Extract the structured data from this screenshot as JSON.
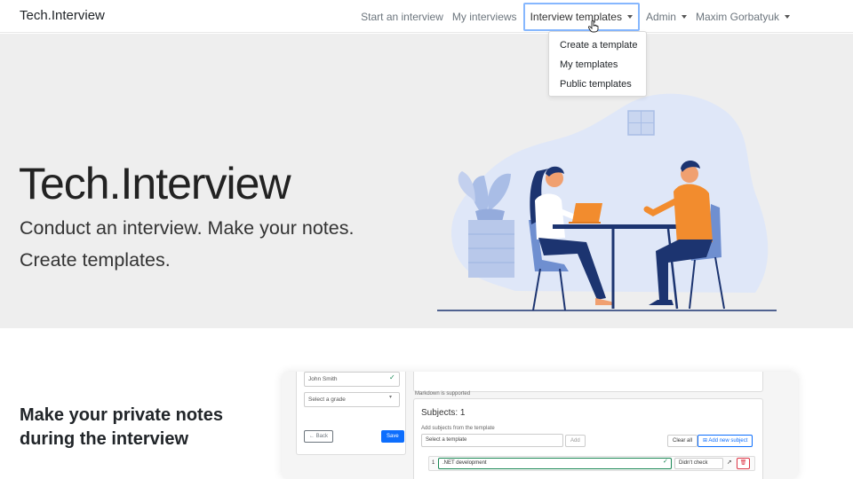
{
  "navbar": {
    "brand": "Tech.Interview",
    "items": [
      {
        "label": "Start an interview"
      },
      {
        "label": "My interviews"
      },
      {
        "label": "Interview templates"
      },
      {
        "label": "Admin"
      },
      {
        "label": "Maxim Gorbatyuk"
      }
    ]
  },
  "dropdown": {
    "items": [
      {
        "label": "Create a template"
      },
      {
        "label": "My templates"
      },
      {
        "label": "Public templates"
      }
    ]
  },
  "hero": {
    "title": "Tech.Interview",
    "subtitle_line1": "Conduct an interview. Make your notes.",
    "subtitle_line2": "Create templates."
  },
  "section2": {
    "title_line1": "Make your private notes",
    "title_line2": "during the interview"
  },
  "preview": {
    "name_value": "John Smith",
    "grade_placeholder": "Select a grade",
    "back_label": "← Back",
    "save_label": "Save",
    "markdown_note": "Markdown is supported",
    "subjects_heading": "Subjects: 1",
    "add_subjects_note": "Add subjects from the template",
    "template_select": "Select a template",
    "add_label": "Add",
    "clear_all_label": "Clear all",
    "add_new_subject_label": "Add new subject",
    "row_number": "1",
    "row_subject": ".NET development",
    "row_status": "Didn't check"
  },
  "colors": {
    "accent": "#0d6efd",
    "hero_bg": "#eeeeee",
    "illustration_orange": "#f28c2e",
    "illustration_navy": "#1c3470",
    "illustration_blue": "#6f8fd0"
  }
}
